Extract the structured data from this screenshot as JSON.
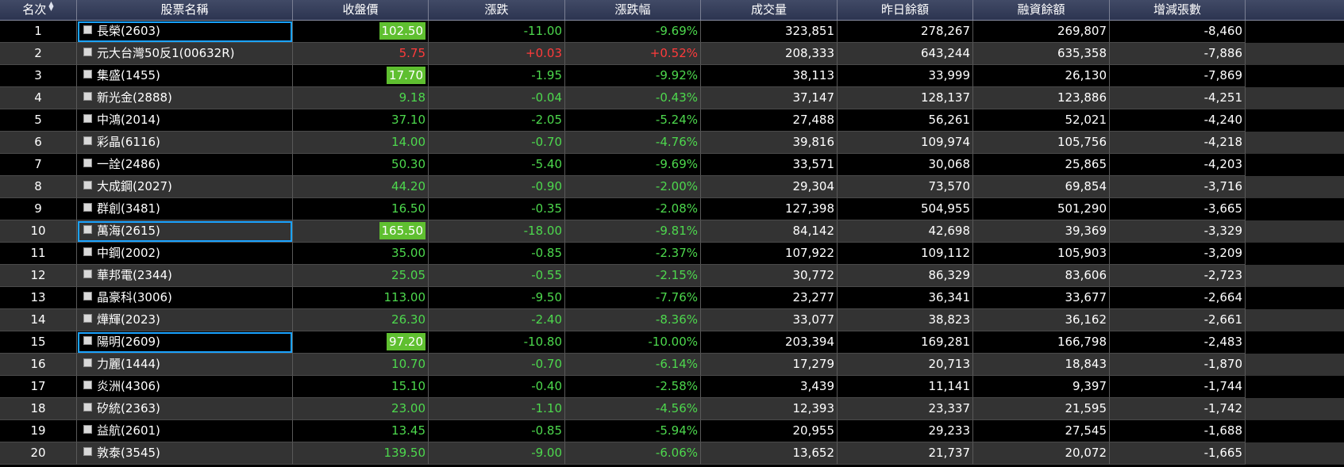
{
  "columns": {
    "rank": "名次",
    "name": "股票名稱",
    "close": "收盤價",
    "change": "漲跌",
    "pct": "漲跌幅",
    "volume": "成交量",
    "prev_balance": "昨日餘額",
    "margin_balance": "融資餘額",
    "delta": "增減張數"
  },
  "sort": {
    "column": "rank",
    "icon": "sort-arrows-icon"
  },
  "colors": {
    "up": "#ff3b3b",
    "down": "#4dd84d",
    "limit_badge": "#5fbf30",
    "selection": "#1aa3ff",
    "header_bg": "#39415c"
  },
  "rows": [
    {
      "rank": "1",
      "name": "長榮(2603)",
      "close": "102.50",
      "change": "-11.00",
      "pct": "-9.69%",
      "volume": "323,851",
      "prev_balance": "278,267",
      "margin_balance": "269,807",
      "delta": "-8,460",
      "dir": "down",
      "limit": true,
      "selected": true
    },
    {
      "rank": "2",
      "name": "元大台灣50反1(00632R)",
      "close": "5.75",
      "change": "+0.03",
      "pct": "+0.52%",
      "volume": "208,333",
      "prev_balance": "643,244",
      "margin_balance": "635,358",
      "delta": "-7,886",
      "dir": "up",
      "limit": false,
      "selected": false
    },
    {
      "rank": "3",
      "name": "集盛(1455)",
      "close": "17.70",
      "change": "-1.95",
      "pct": "-9.92%",
      "volume": "38,113",
      "prev_balance": "33,999",
      "margin_balance": "26,130",
      "delta": "-7,869",
      "dir": "down",
      "limit": true,
      "selected": false
    },
    {
      "rank": "4",
      "name": "新光金(2888)",
      "close": "9.18",
      "change": "-0.04",
      "pct": "-0.43%",
      "volume": "37,147",
      "prev_balance": "128,137",
      "margin_balance": "123,886",
      "delta": "-4,251",
      "dir": "down",
      "limit": false,
      "selected": false
    },
    {
      "rank": "5",
      "name": "中鴻(2014)",
      "close": "37.10",
      "change": "-2.05",
      "pct": "-5.24%",
      "volume": "27,488",
      "prev_balance": "56,261",
      "margin_balance": "52,021",
      "delta": "-4,240",
      "dir": "down",
      "limit": false,
      "selected": false
    },
    {
      "rank": "6",
      "name": "彩晶(6116)",
      "close": "14.00",
      "change": "-0.70",
      "pct": "-4.76%",
      "volume": "39,816",
      "prev_balance": "109,974",
      "margin_balance": "105,756",
      "delta": "-4,218",
      "dir": "down",
      "limit": false,
      "selected": false
    },
    {
      "rank": "7",
      "name": "一詮(2486)",
      "close": "50.30",
      "change": "-5.40",
      "pct": "-9.69%",
      "volume": "33,571",
      "prev_balance": "30,068",
      "margin_balance": "25,865",
      "delta": "-4,203",
      "dir": "down",
      "limit": false,
      "selected": false
    },
    {
      "rank": "8",
      "name": "大成鋼(2027)",
      "close": "44.20",
      "change": "-0.90",
      "pct": "-2.00%",
      "volume": "29,304",
      "prev_balance": "73,570",
      "margin_balance": "69,854",
      "delta": "-3,716",
      "dir": "down",
      "limit": false,
      "selected": false
    },
    {
      "rank": "9",
      "name": "群創(3481)",
      "close": "16.50",
      "change": "-0.35",
      "pct": "-2.08%",
      "volume": "127,398",
      "prev_balance": "504,955",
      "margin_balance": "501,290",
      "delta": "-3,665",
      "dir": "down",
      "limit": false,
      "selected": false
    },
    {
      "rank": "10",
      "name": "萬海(2615)",
      "close": "165.50",
      "change": "-18.00",
      "pct": "-9.81%",
      "volume": "84,142",
      "prev_balance": "42,698",
      "margin_balance": "39,369",
      "delta": "-3,329",
      "dir": "down",
      "limit": true,
      "selected": true
    },
    {
      "rank": "11",
      "name": "中鋼(2002)",
      "close": "35.00",
      "change": "-0.85",
      "pct": "-2.37%",
      "volume": "107,922",
      "prev_balance": "109,112",
      "margin_balance": "105,903",
      "delta": "-3,209",
      "dir": "down",
      "limit": false,
      "selected": false
    },
    {
      "rank": "12",
      "name": "華邦電(2344)",
      "close": "25.05",
      "change": "-0.55",
      "pct": "-2.15%",
      "volume": "30,772",
      "prev_balance": "86,329",
      "margin_balance": "83,606",
      "delta": "-2,723",
      "dir": "down",
      "limit": false,
      "selected": false
    },
    {
      "rank": "13",
      "name": "晶豪科(3006)",
      "close": "113.00",
      "change": "-9.50",
      "pct": "-7.76%",
      "volume": "23,277",
      "prev_balance": "36,341",
      "margin_balance": "33,677",
      "delta": "-2,664",
      "dir": "down",
      "limit": false,
      "selected": false
    },
    {
      "rank": "14",
      "name": "燁輝(2023)",
      "close": "26.30",
      "change": "-2.40",
      "pct": "-8.36%",
      "volume": "33,077",
      "prev_balance": "38,823",
      "margin_balance": "36,162",
      "delta": "-2,661",
      "dir": "down",
      "limit": false,
      "selected": false
    },
    {
      "rank": "15",
      "name": "陽明(2609)",
      "close": "97.20",
      "change": "-10.80",
      "pct": "-10.00%",
      "volume": "203,394",
      "prev_balance": "169,281",
      "margin_balance": "166,798",
      "delta": "-2,483",
      "dir": "down",
      "limit": true,
      "selected": true
    },
    {
      "rank": "16",
      "name": "力麗(1444)",
      "close": "10.70",
      "change": "-0.70",
      "pct": "-6.14%",
      "volume": "17,279",
      "prev_balance": "20,713",
      "margin_balance": "18,843",
      "delta": "-1,870",
      "dir": "down",
      "limit": false,
      "selected": false
    },
    {
      "rank": "17",
      "name": "炎洲(4306)",
      "close": "15.10",
      "change": "-0.40",
      "pct": "-2.58%",
      "volume": "3,439",
      "prev_balance": "11,141",
      "margin_balance": "9,397",
      "delta": "-1,744",
      "dir": "down",
      "limit": false,
      "selected": false
    },
    {
      "rank": "18",
      "name": "矽統(2363)",
      "close": "23.00",
      "change": "-1.10",
      "pct": "-4.56%",
      "volume": "12,393",
      "prev_balance": "23,337",
      "margin_balance": "21,595",
      "delta": "-1,742",
      "dir": "down",
      "limit": false,
      "selected": false
    },
    {
      "rank": "19",
      "name": "益航(2601)",
      "close": "13.45",
      "change": "-0.85",
      "pct": "-5.94%",
      "volume": "20,955",
      "prev_balance": "29,233",
      "margin_balance": "27,545",
      "delta": "-1,688",
      "dir": "down",
      "limit": false,
      "selected": false
    },
    {
      "rank": "20",
      "name": "敦泰(3545)",
      "close": "139.50",
      "change": "-9.00",
      "pct": "-6.06%",
      "volume": "13,652",
      "prev_balance": "21,737",
      "margin_balance": "20,072",
      "delta": "-1,665",
      "dir": "down",
      "limit": false,
      "selected": false
    }
  ]
}
